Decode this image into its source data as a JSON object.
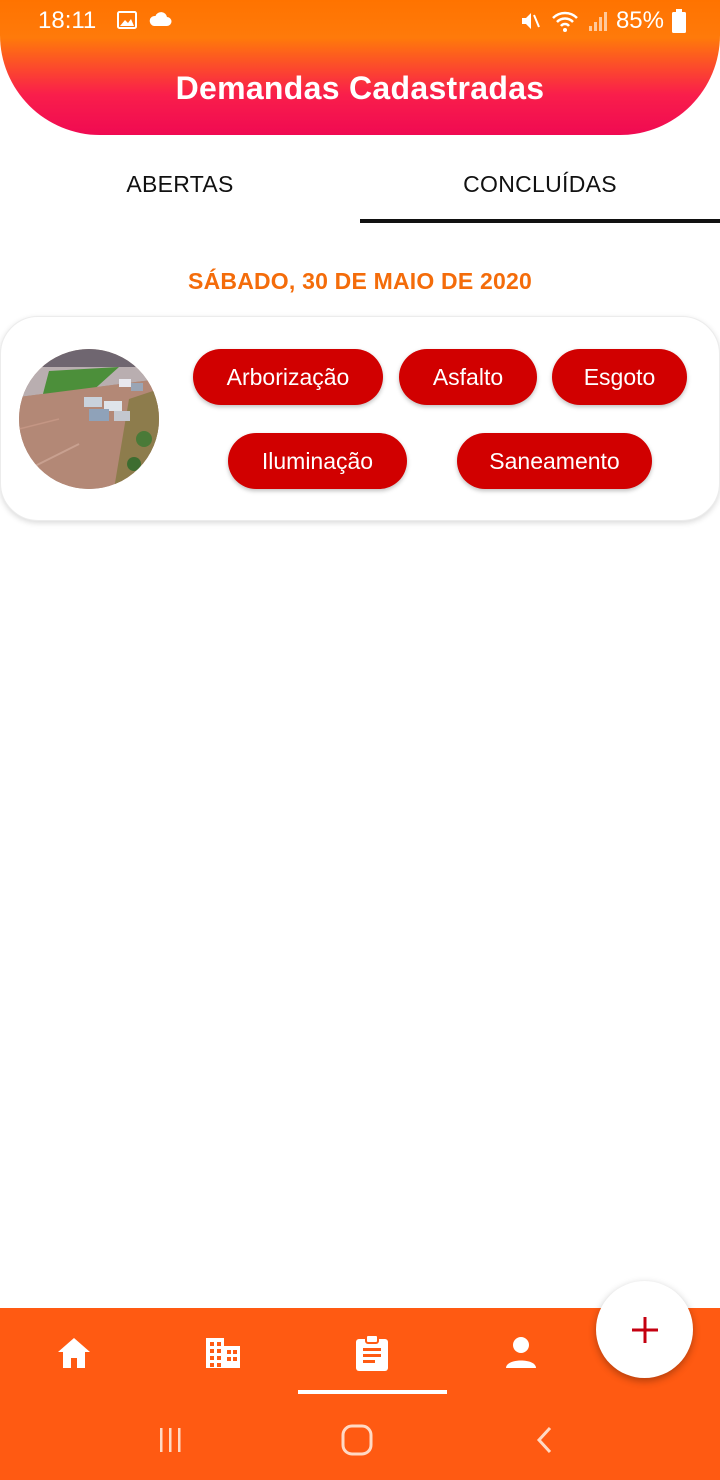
{
  "status_bar": {
    "time": "18:11",
    "battery": "85%",
    "icons": [
      "image-icon",
      "cloud-icon",
      "mute-icon",
      "wifi-icon",
      "signal-icon",
      "battery-icon"
    ]
  },
  "header": {
    "title": "Demandas Cadastradas"
  },
  "tabs": [
    {
      "label": "ABERTAS",
      "active": false
    },
    {
      "label": "CONCLUÍDAS",
      "active": true
    }
  ],
  "date_heading": "SÁBADO, 30 DE MAIO DE 2020",
  "demand_card": {
    "photo": "flooded-street-photo",
    "categories": [
      "Arborização",
      "Asfalto",
      "Esgoto",
      "Iluminação",
      "Saneamento"
    ]
  },
  "bottom_nav": {
    "items": [
      "home-icon",
      "building-icon",
      "clipboard-icon",
      "person-icon"
    ],
    "active_item": "clipboard-icon"
  },
  "fab": {
    "icon": "plus-icon"
  },
  "system_nav": [
    "recent-apps-icon",
    "home-circle-icon",
    "back-icon"
  ],
  "colors": {
    "header_top": "#ff7300",
    "header_bottom": "#f00a52",
    "chip": "#d10000",
    "date_heading": "#f46c0a",
    "bottom_nav": "#ff5a12",
    "fab_plus": "#c40010"
  }
}
